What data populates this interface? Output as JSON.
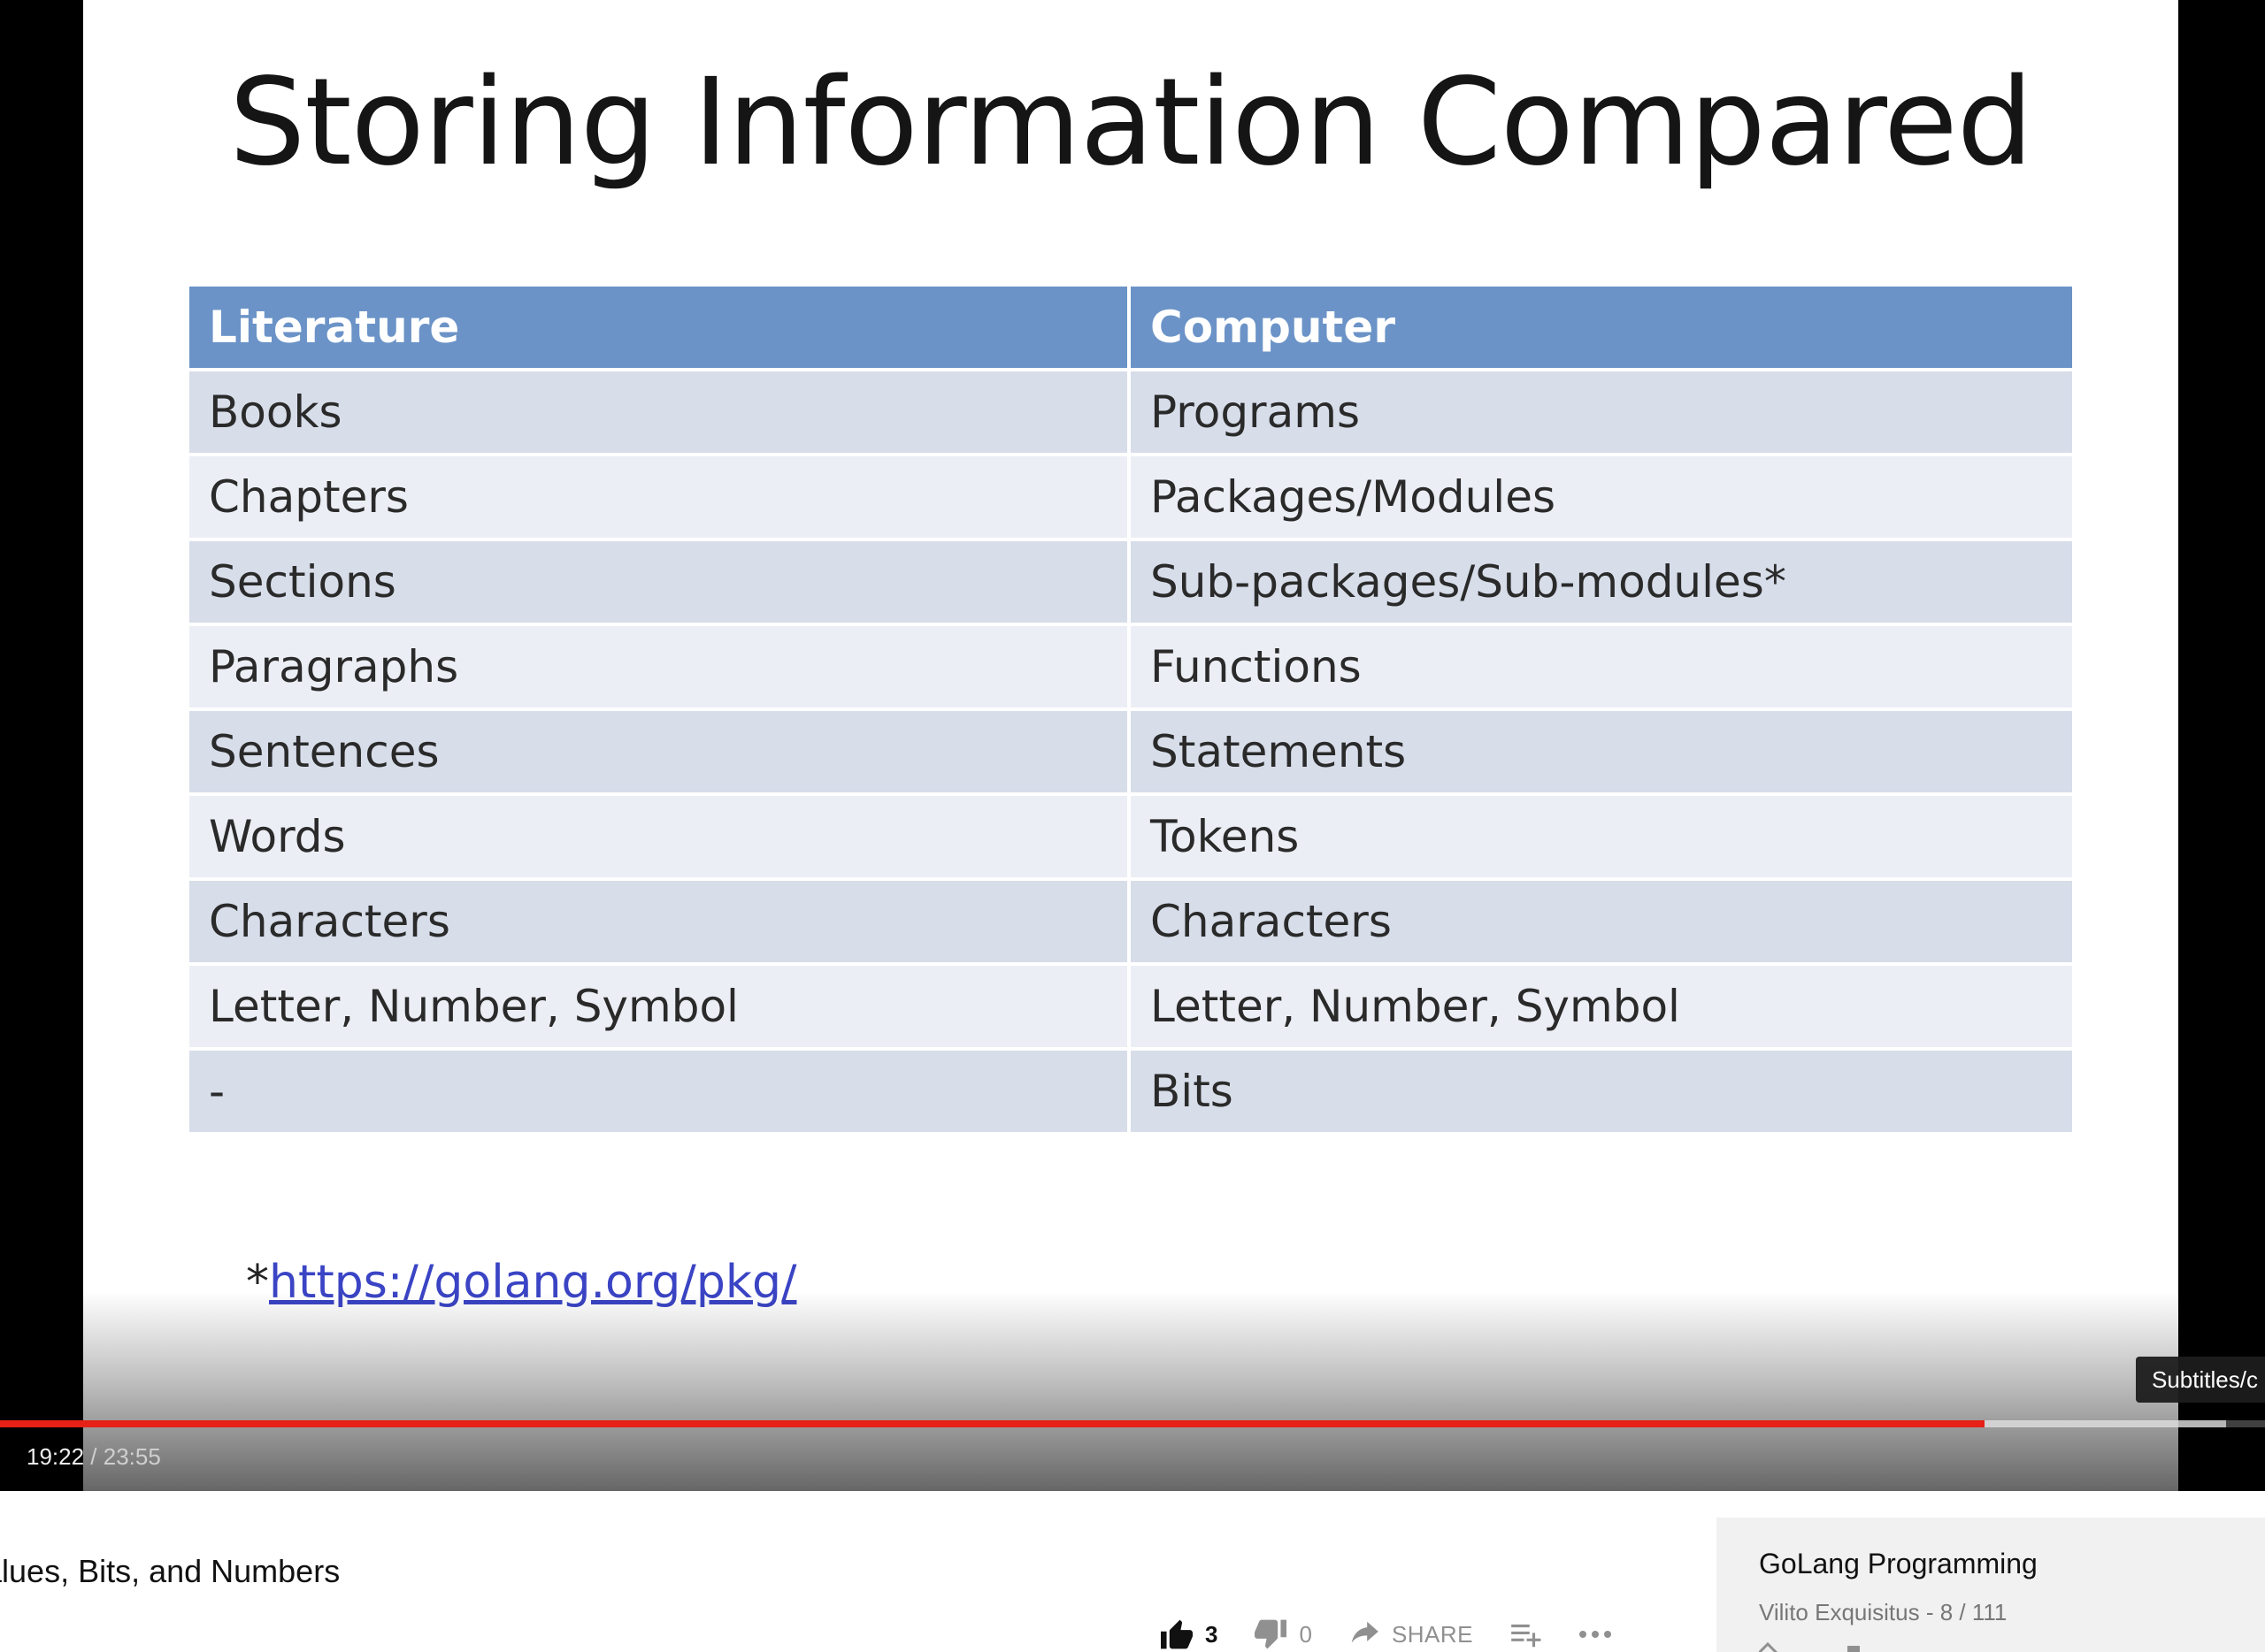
{
  "slide": {
    "title": "Storing Information Compared",
    "table": {
      "headers": [
        "Literature",
        "Computer"
      ],
      "rows": [
        [
          "Books",
          "Programs"
        ],
        [
          "Chapters",
          "Packages/Modules"
        ],
        [
          "Sections",
          "Sub-packages/Sub-modules*"
        ],
        [
          "Paragraphs",
          "Functions"
        ],
        [
          "Sentences",
          "Statements"
        ],
        [
          "Words",
          "Tokens"
        ],
        [
          "Characters",
          "Characters"
        ],
        [
          "Letter, Number, Symbol",
          "Letter, Number, Symbol"
        ],
        [
          "-",
          "Bits"
        ]
      ]
    },
    "footnote_marker": "*",
    "footnote_link": "https://golang.org/pkg/"
  },
  "player": {
    "current_time": "19:22",
    "separator": " / ",
    "duration": "23:55",
    "progress_fraction": 0.876,
    "buffered_fraction": 0.983,
    "tooltip": "Subtitles/c",
    "colors": {
      "played": "#e62117",
      "header": "#6b93c7"
    }
  },
  "video": {
    "title": "alues, Bits, and Numbers",
    "likes": "3",
    "dislikes": "0",
    "share_label": "SHARE",
    "icons": [
      "thumb-up-icon",
      "thumb-down-icon",
      "share-arrow-icon",
      "add-to-playlist-icon",
      "more-icon"
    ]
  },
  "playlist": {
    "title": "GoLang Programming",
    "meta": "Vilito Exquisitus - 8 / 111"
  }
}
